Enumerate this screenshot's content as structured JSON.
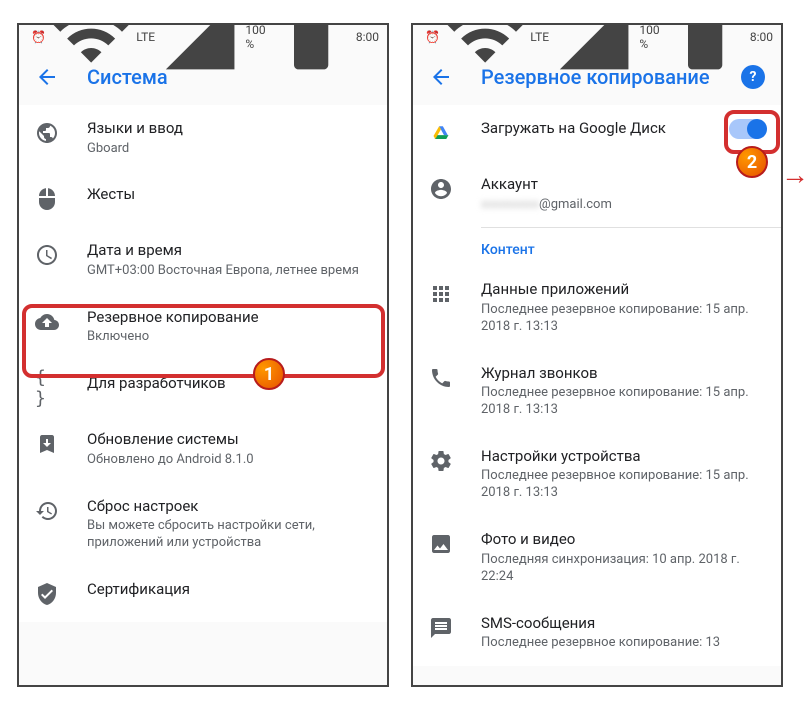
{
  "status": {
    "battery": "100 %",
    "time": "8:00",
    "net": "LTE"
  },
  "left": {
    "title": "Система",
    "items": {
      "lang": {
        "title": "Языки и ввод",
        "sub": "Gboard"
      },
      "gest": {
        "title": "Жесты"
      },
      "date": {
        "title": "Дата и время",
        "sub": "GMT+03:00 Восточная Европа, летнее время"
      },
      "backup": {
        "title": "Резервное копирование",
        "sub": "Включено"
      },
      "dev": {
        "title": "Для разработчиков"
      },
      "update": {
        "title": "Обновление системы",
        "sub": "Обновлено до Android 8.1.0"
      },
      "reset": {
        "title": "Сброс настроек",
        "sub": "Вы можете сбросить настройки сети, приложений или устройства"
      },
      "cert": {
        "title": "Сертификация"
      }
    }
  },
  "right": {
    "title": "Резервное копирование",
    "upload": {
      "title": "Загружать на Google Диск"
    },
    "account": {
      "title": "Аккаунт",
      "sub": "@gmail.com"
    },
    "section": "Контент",
    "items": {
      "apps": {
        "title": "Данные приложений",
        "sub": "Последнее резервное копирование: 15 апр. 2018 г. 13:13"
      },
      "calls": {
        "title": "Журнал звонков",
        "sub": "Последнее резервное копирование: 15 апр. 2018 г. 13:13"
      },
      "settings": {
        "title": "Настройки устройства",
        "sub": "Последнее резервное копирование: 15 апр. 2018 г. 13:13"
      },
      "photo": {
        "title": "Фото и видео",
        "sub": "Последняя синхронизация: 10 апр. 2018 г. 22:24"
      },
      "sms": {
        "title": "SMS-сообщения",
        "sub": "Последнее резервное копирование: 13"
      }
    }
  },
  "badges": {
    "one": "1",
    "two": "2"
  }
}
